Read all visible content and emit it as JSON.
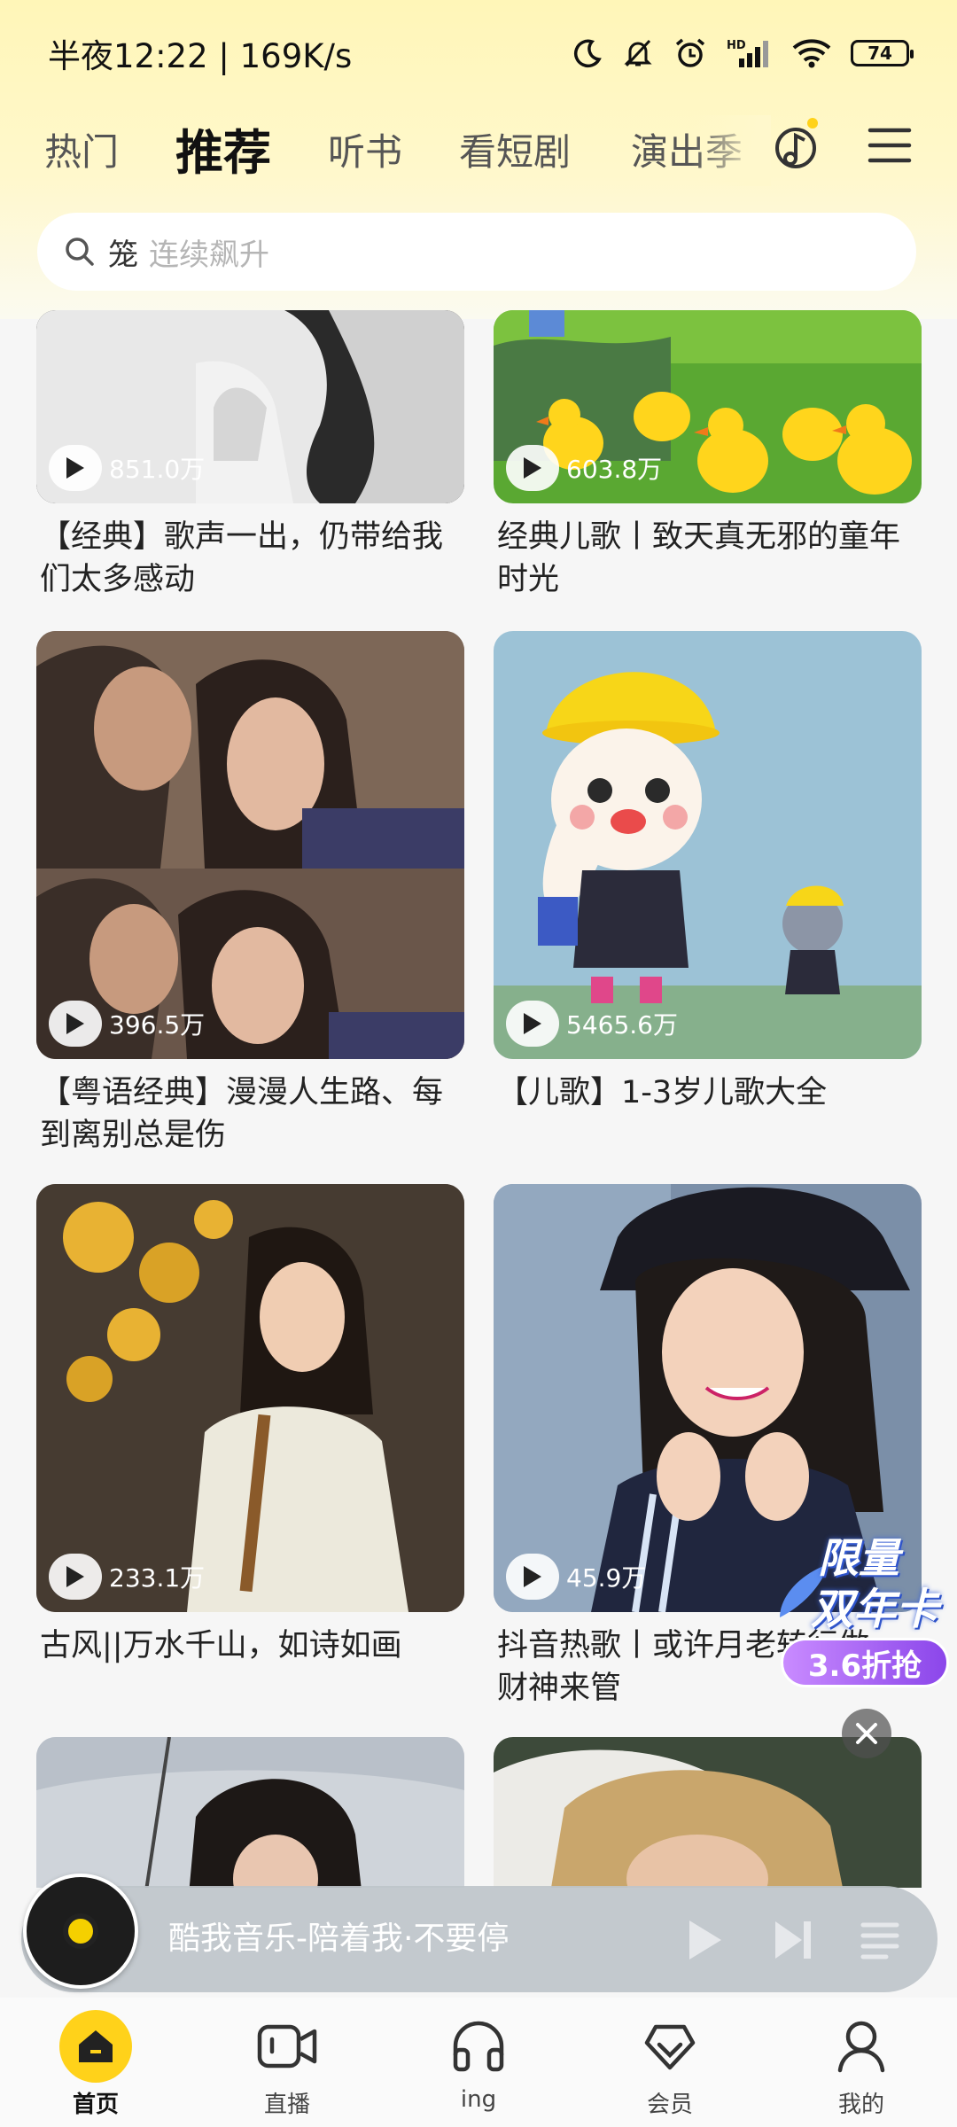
{
  "status_bar": {
    "time": "半夜12:22 | 169K/s",
    "battery": "74",
    "network_label": "HD"
  },
  "tabs": [
    {
      "label": "热门",
      "active": false
    },
    {
      "label": "推荐",
      "active": true
    },
    {
      "label": "听书",
      "active": false
    },
    {
      "label": "看短剧",
      "active": false
    },
    {
      "label": "演出季",
      "active": false
    }
  ],
  "search": {
    "keyword": "笼",
    "placeholder": "连续飙升"
  },
  "feed": [
    {
      "play_count": "851.0万",
      "title": "【经典】歌声一出，仍带给我们太多感动"
    },
    {
      "play_count": "603.8万",
      "title": "经典儿歌丨致天真无邪的童年时光"
    },
    {
      "play_count": "396.5万",
      "title": "【粤语经典】漫漫人生路、每到离别总是伤"
    },
    {
      "play_count": "5465.6万",
      "title": "【儿歌】1-3岁儿歌大全"
    },
    {
      "play_count": "233.1万",
      "title": "古风||万水千山，如诗如画"
    },
    {
      "play_count": "45.9万",
      "title": "抖音热歌丨或许月老转行做财神来管"
    }
  ],
  "promo": {
    "line1": "限量",
    "line2": "双年卡",
    "button": "3.6折抢"
  },
  "player": {
    "now_playing": "酷我音乐-陪着我·不要停"
  },
  "bottom_nav": [
    {
      "label": "首页",
      "icon": "home-icon",
      "active": true
    },
    {
      "label": "直播",
      "icon": "live-video-icon",
      "active": false
    },
    {
      "label": "ing",
      "icon": "headphones-icon",
      "active": false
    },
    {
      "label": "会员",
      "icon": "vip-heart-icon",
      "active": false
    },
    {
      "label": "我的",
      "icon": "profile-icon",
      "active": false
    }
  ],
  "colors": {
    "accent": "#ffd21a",
    "header_bg": "#fff6b8",
    "promo_purple": "#8b46ea"
  }
}
